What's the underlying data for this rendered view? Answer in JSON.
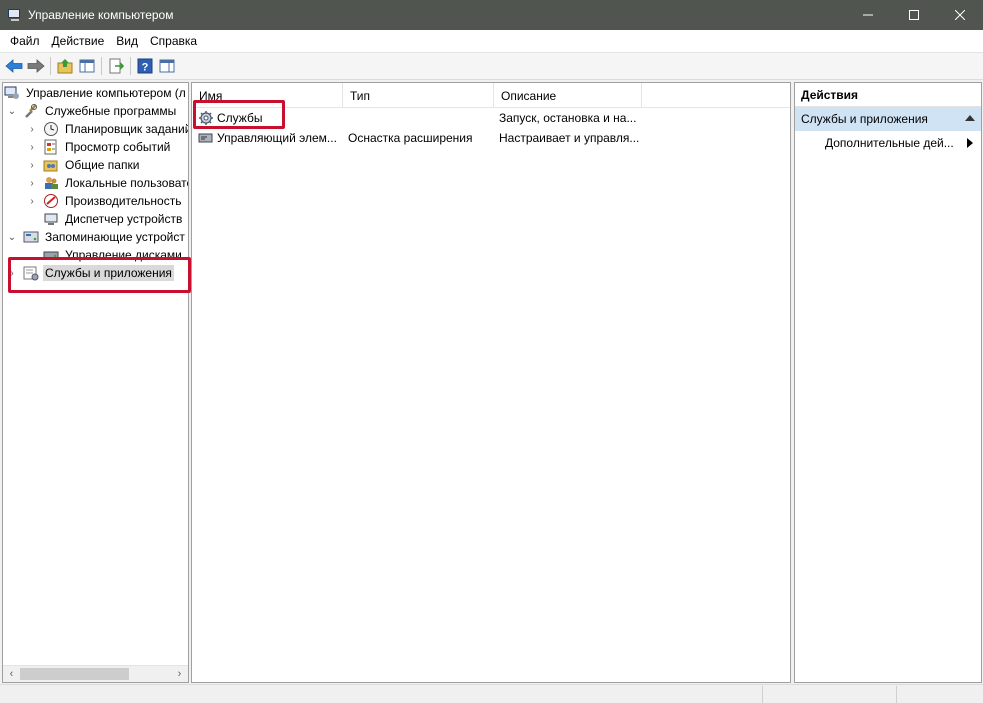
{
  "window": {
    "title": "Управление компьютером"
  },
  "menu": [
    "Файл",
    "Действие",
    "Вид",
    "Справка"
  ],
  "toolbar": {
    "icons": [
      "back-arrow-icon",
      "forward-arrow-icon",
      "up-folder-icon",
      "show-hide-tree-icon",
      "export-list-icon",
      "help-icon",
      "properties-icon"
    ]
  },
  "tree": {
    "items": [
      {
        "label": "Управление компьютером (л",
        "icon": "computer-management-icon",
        "expander": ""
      },
      {
        "label": "Служебные программы",
        "icon": "tools-icon",
        "expander": "⌄"
      },
      {
        "label": "Планировщик заданий",
        "icon": "clock-icon",
        "expander": "›"
      },
      {
        "label": "Просмотр событий",
        "icon": "event-viewer-icon",
        "expander": "›"
      },
      {
        "label": "Общие папки",
        "icon": "shared-folders-icon",
        "expander": "›"
      },
      {
        "label": "Локальные пользовате",
        "icon": "users-icon",
        "expander": "›"
      },
      {
        "label": "Производительность",
        "icon": "performance-icon",
        "expander": "›"
      },
      {
        "label": "Диспетчер устройств",
        "icon": "device-manager-icon",
        "expander": ""
      },
      {
        "label": "Запоминающие устройст",
        "icon": "storage-icon",
        "expander": "⌄"
      },
      {
        "label": "Управление дисками",
        "icon": "disk-management-icon",
        "expander": ""
      },
      {
        "label": "Службы и приложения",
        "icon": "services-apps-icon",
        "expander": "›"
      }
    ]
  },
  "list": {
    "columns": [
      "Имя",
      "Тип",
      "Описание"
    ],
    "rows": [
      {
        "name": "Службы",
        "type": "",
        "description": "Запуск, остановка и на...",
        "icon": "services-gear-icon"
      },
      {
        "name": "Управляющий элем...",
        "type": "Оснастка расширения",
        "description": "Настраивает и управля...",
        "icon": "wmi-control-icon"
      }
    ]
  },
  "actions": {
    "header": "Действия",
    "group": "Службы и приложения",
    "items": [
      "Дополнительные дей..."
    ]
  },
  "colors": {
    "titlebar": "#50564f",
    "selection": "#cfe3f5",
    "highlight": "#c8102e"
  }
}
